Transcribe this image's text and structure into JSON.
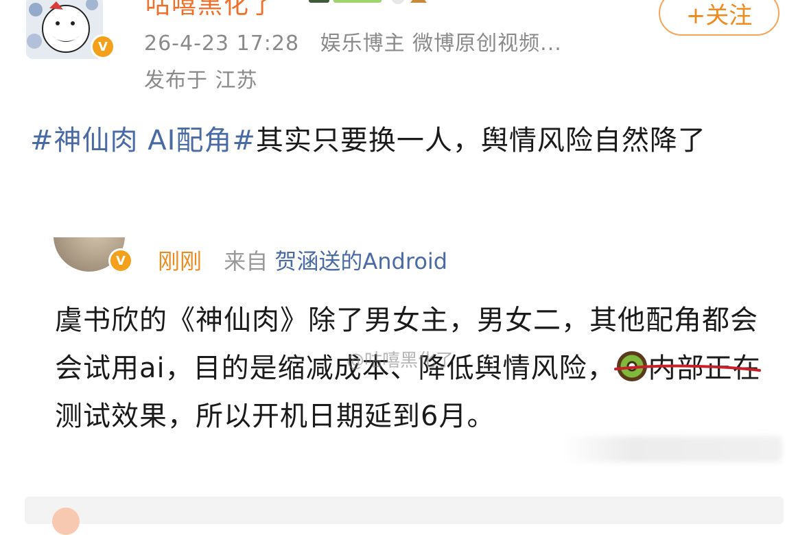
{
  "post": {
    "username": "咕嘻黑化了",
    "follow_label": "+关注",
    "date": "26-4-23 17:28",
    "category": "娱乐博主 微博原创视频...",
    "location": "发布于 江苏",
    "hashtag": "#神仙肉 AI配角#",
    "text": "其实只要换一人，舆情风险自然降了"
  },
  "quoted": {
    "time": "刚刚",
    "from_prefix": "来自",
    "device": "贺涵送的Android",
    "text_part1": "虞书欣的《神仙肉》除了男女主，男女二，其他配角都会会试用ai，目的是缩减成本、降低舆情风险，",
    "text_part2": "内部正在测试效果，所以开机日期延到6月。",
    "emoji_icon": "kiwi-icon"
  },
  "watermark": "@咕嘻黑化了",
  "colors": {
    "username": "#f0702b",
    "link": "#4a6aa6",
    "meta": "#8a8a8a",
    "follow_border": "#f5a45a",
    "verified_badge": "#f4a01b",
    "highlight_underline": "#c8202a"
  }
}
